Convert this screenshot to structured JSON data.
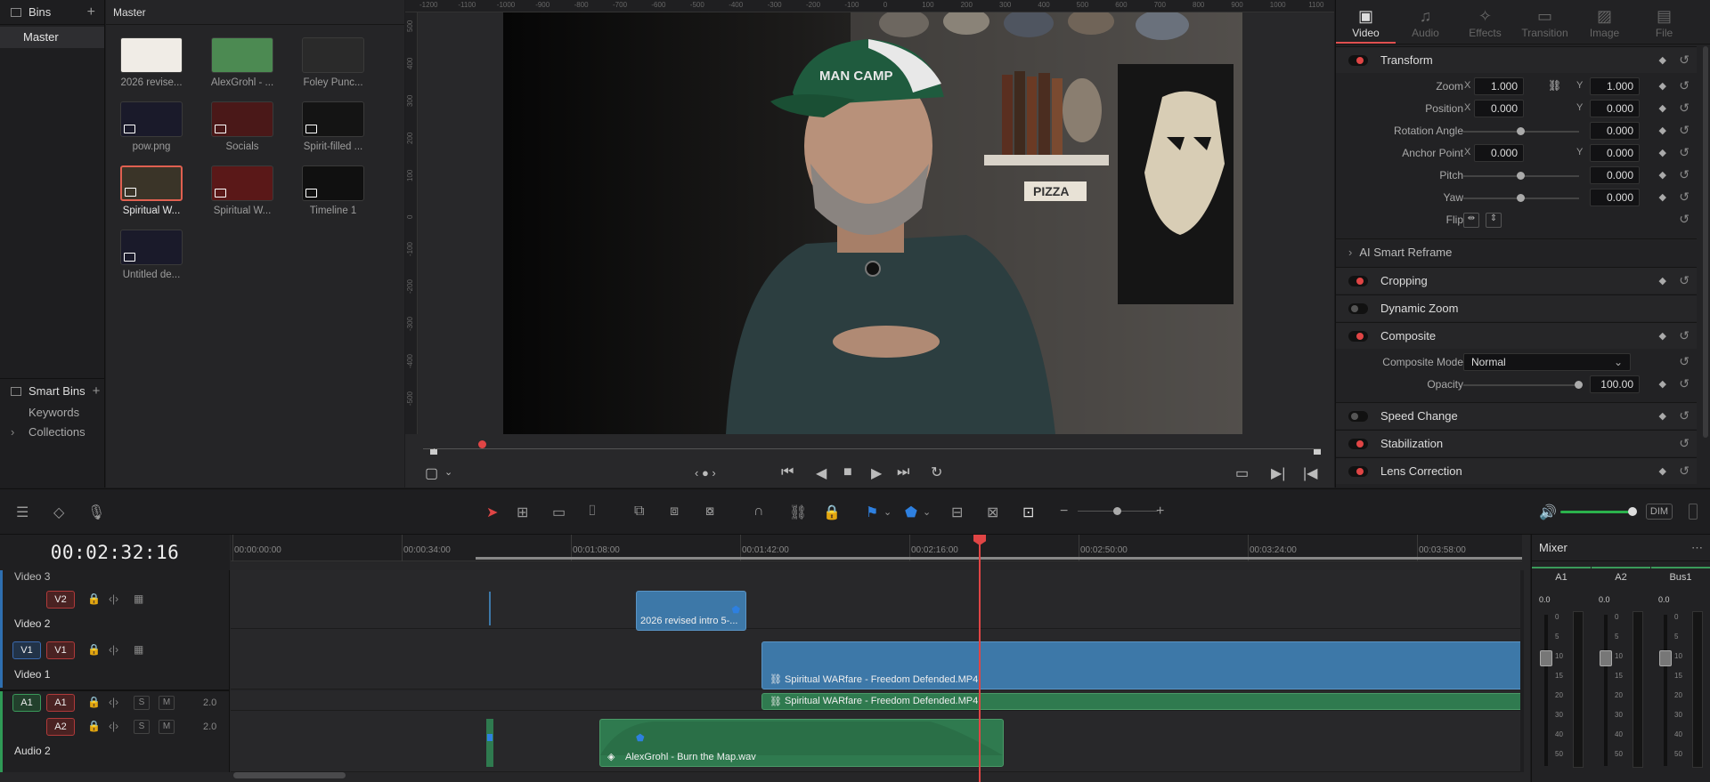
{
  "bins": {
    "title": "Bins",
    "master": "Master",
    "smart_bins_title": "Smart Bins",
    "smart_items": [
      "Keywords",
      "Collections"
    ]
  },
  "media_pool": {
    "title": "Master",
    "clips": [
      {
        "label": "2026 revise...",
        "selected": false,
        "kind": "title"
      },
      {
        "label": "AlexGrohl - ...",
        "selected": false,
        "kind": "audio"
      },
      {
        "label": "Foley Punc...",
        "selected": false,
        "kind": "audio-dark"
      },
      {
        "label": "pow.png",
        "selected": false,
        "kind": "image"
      },
      {
        "label": "Socials",
        "selected": false,
        "kind": "timeline-red"
      },
      {
        "label": "Spirit-filled ...",
        "selected": false,
        "kind": "image-dark"
      },
      {
        "label": "Spiritual W...",
        "selected": true,
        "kind": "video"
      },
      {
        "label": "Spiritual W...",
        "selected": false,
        "kind": "audio-red"
      },
      {
        "label": "Timeline 1",
        "selected": false,
        "kind": "timeline"
      },
      {
        "label": "Untitled de...",
        "selected": false,
        "kind": "image"
      }
    ]
  },
  "viewer": {
    "ruler_top_ticks": [
      "-1200",
      "-1100",
      "-1000",
      "-900",
      "-800",
      "-700",
      "-600",
      "-500",
      "-400",
      "-300",
      "-200",
      "-100",
      "0",
      "100",
      "200",
      "300",
      "400",
      "500",
      "600",
      "700",
      "800",
      "900",
      "1000",
      "1100"
    ],
    "ruler_left_ticks": [
      "500",
      "400",
      "300",
      "200",
      "100",
      "0",
      "-100",
      "-200",
      "-300",
      "-400",
      "-500"
    ],
    "overlay_text": {
      "cap": "MAN CAMP",
      "sign": "PIZZA"
    }
  },
  "inspector": {
    "tabs": [
      {
        "label": "Video",
        "icon": "video-icon",
        "active": true
      },
      {
        "label": "Audio",
        "icon": "music-note-icon",
        "active": false
      },
      {
        "label": "Effects",
        "icon": "effects-wand-icon",
        "active": false
      },
      {
        "label": "Transition",
        "icon": "transition-icon",
        "active": false
      },
      {
        "label": "Image",
        "icon": "image-icon",
        "active": false
      },
      {
        "label": "File",
        "icon": "file-icon",
        "active": false
      }
    ],
    "transform": {
      "title": "Transform",
      "zoom_label": "Zoom",
      "zoom_x": "1.000",
      "zoom_y": "1.000",
      "position_label": "Position",
      "position_x": "0.000",
      "position_y": "0.000",
      "rotation_label": "Rotation Angle",
      "rotation": "0.000",
      "anchor_label": "Anchor Point",
      "anchor_x": "0.000",
      "anchor_y": "0.000",
      "pitch_label": "Pitch",
      "pitch": "0.000",
      "yaw_label": "Yaw",
      "yaw": "0.000",
      "flip_label": "Flip",
      "x": "X",
      "y": "Y"
    },
    "ai_smart_reframe": "AI Smart Reframe",
    "cropping": "Cropping",
    "dynamic_zoom": "Dynamic Zoom",
    "composite": {
      "title": "Composite",
      "mode_label": "Composite Mode",
      "mode_value": "Normal",
      "opacity_label": "Opacity",
      "opacity": "100.00"
    },
    "speed_change": "Speed Change",
    "stabilization": "Stabilization",
    "lens_correction": "Lens Correction"
  },
  "toolbar": {
    "dim_label": "DIM"
  },
  "timeline": {
    "timecode": "00:02:32:16",
    "ruler_ticks": [
      "00:00:00:00",
      "00:00:34:00",
      "00:01:08:00",
      "00:01:42:00",
      "00:02:16:00",
      "00:02:50:00",
      "00:03:24:00",
      "00:03:58:00"
    ],
    "tracks": {
      "video3": "Video 3",
      "video2": "Video 2",
      "video1": "Video 1",
      "audio2": "Audio 2",
      "v2": "V2",
      "v1_src": "V1",
      "v1": "V1",
      "a1_src": "A1",
      "a1": "A1",
      "a2": "A2",
      "a1_level": "2.0",
      "a2_level": "2.0",
      "s": "S",
      "m": "M"
    },
    "clips": {
      "intro": "2026 revised intro 5-...",
      "video_main": "Spiritual WARfare - Freedom Defended.MP4",
      "audio_main": "Spiritual WARfare - Freedom Defended.MP4",
      "music": "AlexGrohl - Burn the Map.wav"
    }
  },
  "mixer": {
    "title": "Mixer",
    "channels": [
      {
        "name": "A1",
        "value": "0.0"
      },
      {
        "name": "A2",
        "value": "0.0"
      },
      {
        "name": "Bus1",
        "value": "0.0"
      }
    ],
    "scale": [
      "0",
      "5",
      "10",
      "15",
      "20",
      "30",
      "40",
      "50"
    ]
  }
}
